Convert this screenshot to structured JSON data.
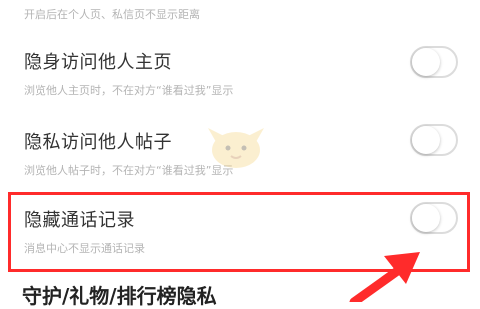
{
  "top_description": "开启后在个人页、私信页不显示距离",
  "settings": [
    {
      "title": "隐身访问他人主页",
      "description": "浏览他人主页时，不在对方“谁看过我”显示",
      "enabled": false
    },
    {
      "title": "隐私访问他人帖子",
      "description": "浏览他人帖子时，不在对方“谁看过我”显示",
      "enabled": false
    },
    {
      "title": "隐藏通话记录",
      "description": "消息中心不显示通话记录",
      "enabled": false
    }
  ],
  "section_heading": "守护/礼物/排行榜隐私",
  "colors": {
    "highlight": "#ff2b2b",
    "toggle_border": "#dcdcdc",
    "title_text": "#333333",
    "desc_text": "#b4b4b4"
  },
  "icons": {
    "annotation_arrow": "red-arrow-icon",
    "watermark": "mascot-icon"
  }
}
